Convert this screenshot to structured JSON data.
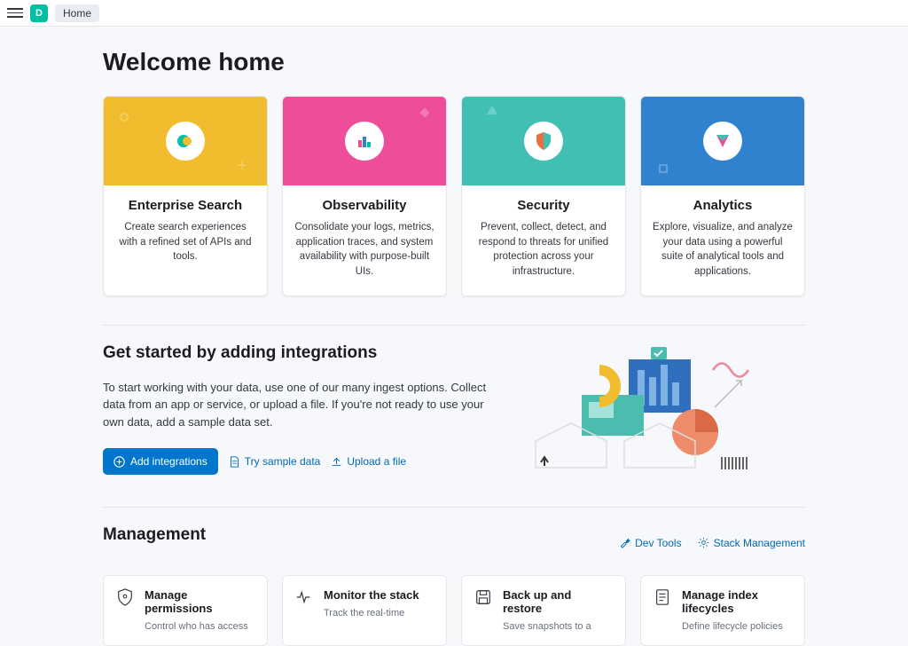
{
  "topbar": {
    "logo_letter": "D",
    "breadcrumb": "Home"
  },
  "page_title": "Welcome home",
  "solutions": [
    {
      "title": "Enterprise Search",
      "desc": "Create search experiences with a refined set of APIs and tools."
    },
    {
      "title": "Observability",
      "desc": "Consolidate your logs, metrics, application traces, and system availability with purpose-built UIs."
    },
    {
      "title": "Security",
      "desc": "Prevent, collect, detect, and respond to threats for unified protection across your infrastructure."
    },
    {
      "title": "Analytics",
      "desc": "Explore, visualize, and analyze your data using a powerful suite of analytical tools and applications."
    }
  ],
  "integrations": {
    "heading": "Get started by adding integrations",
    "desc": "To start working with your data, use one of our many ingest options. Collect data from an app or service, or upload a file. If you're not ready to use your own data, add a sample data set.",
    "add_btn": "Add integrations",
    "sample_link": "Try sample data",
    "upload_link": "Upload a file"
  },
  "management": {
    "heading": "Management",
    "devtools_link": "Dev Tools",
    "stack_link": "Stack Management",
    "cards": [
      {
        "title": "Manage permissions",
        "desc": "Control who has access and"
      },
      {
        "title": "Monitor the stack",
        "desc": "Track the real-time health and"
      },
      {
        "title": "Back up and restore",
        "desc": "Save snapshots to a backup"
      },
      {
        "title": "Manage index lifecycles",
        "desc": "Define lifecycle policies to"
      }
    ]
  }
}
